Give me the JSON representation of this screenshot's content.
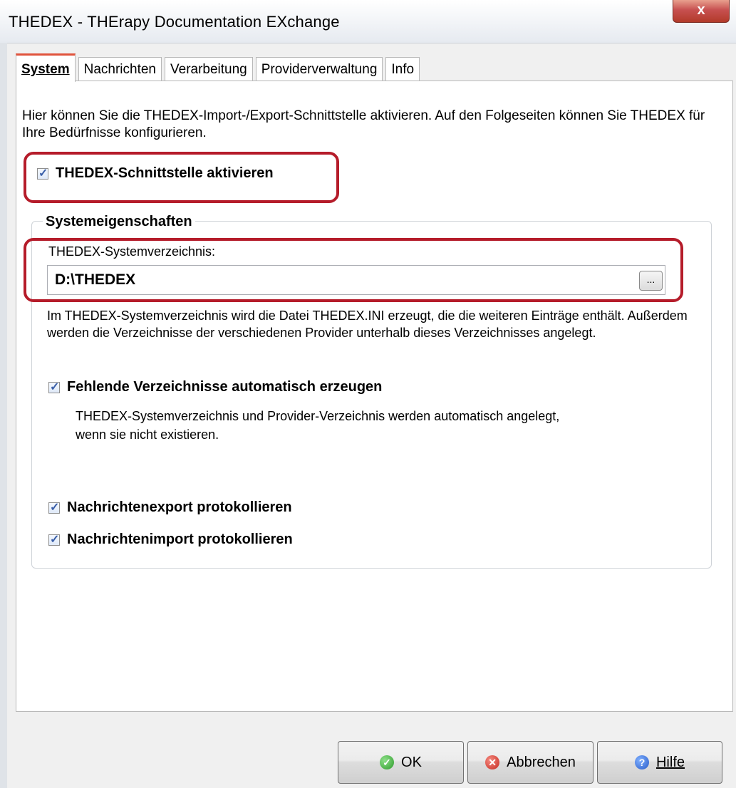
{
  "window": {
    "title": "THEDEX - THErapy Documentation EXchange",
    "close_label": "x"
  },
  "tabs": [
    {
      "label": "System",
      "active": true
    },
    {
      "label": "Nachrichten",
      "active": false
    },
    {
      "label": "Verarbeitung",
      "active": false
    },
    {
      "label": "Providerverwaltung",
      "active": false
    },
    {
      "label": "Info",
      "active": false
    }
  ],
  "system": {
    "intro": "Hier können Sie die THEDEX-Import-/Export-Schnittstelle aktivieren. Auf den Folgeseiten können Sie THEDEX für Ihre Bedürfnisse konfigurieren.",
    "activate": {
      "label": "THEDEX-Schnittstelle aktivieren",
      "checked": true
    },
    "group_title": "Systemeigenschaften",
    "dir_label": "THEDEX-Systemverzeichnis:",
    "dir_value": "D:\\THEDEX",
    "browse_label": "...",
    "dir_description": "Im THEDEX-Systemverzeichnis wird die Datei THEDEX.INI erzeugt, die die weiteren Einträge enthält. Außerdem werden die Verzeichnisse der verschiedenen Provider unterhalb dieses Verzeichnisses angelegt.",
    "create_dirs": {
      "label": "Fehlende Verzeichnisse automatisch erzeugen",
      "checked": true,
      "description": "THEDEX-Systemverzeichnis und Provider-Verzeichnis werden automatisch angelegt, wenn sie nicht existieren."
    },
    "log_export": {
      "label": "Nachrichtenexport protokollieren",
      "checked": true
    },
    "log_import": {
      "label": "Nachrichtenimport protokollieren",
      "checked": true
    }
  },
  "buttons": {
    "ok": "OK",
    "cancel": "Abbrechen",
    "help": "Hilfe"
  },
  "colors": {
    "highlight": "#b51c2a",
    "active_tab_accent": "#e0533c",
    "close_button": "#c75050"
  },
  "icons": {
    "ok": "ok-check-icon",
    "cancel": "cancel-x-icon",
    "help": "help-question-icon"
  }
}
